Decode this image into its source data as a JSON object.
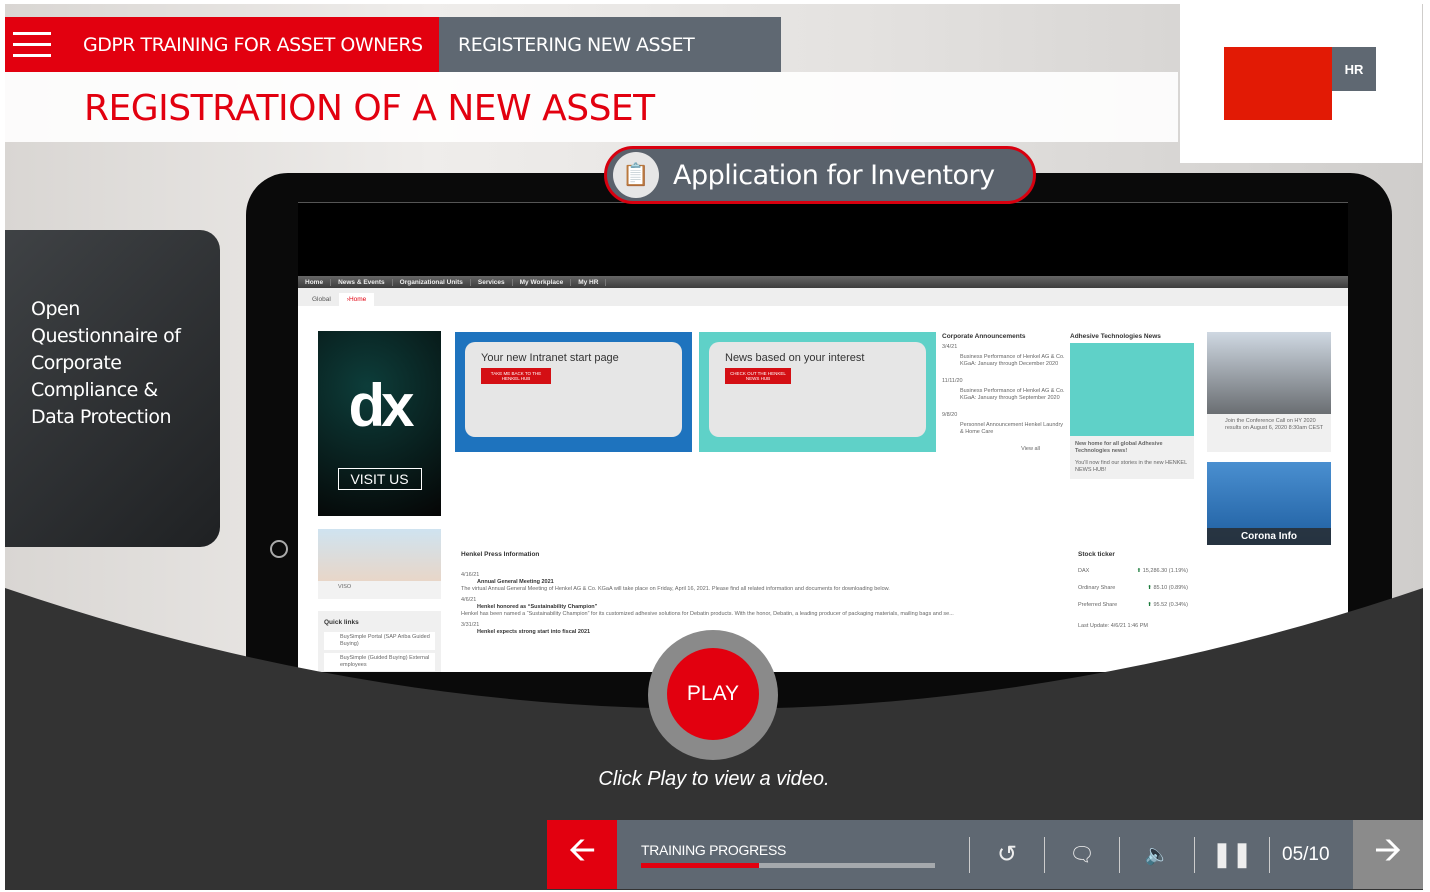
{
  "header": {
    "course": "GDPR TRAINING FOR ASSET OWNERS",
    "section": "REGISTERING NEW ASSET",
    "title": "REGISTRATION OF A NEW ASSET"
  },
  "logo": {
    "badge": "HR"
  },
  "pill": {
    "label": "Application for Inventory",
    "icon": "clipboard-inventory-icon"
  },
  "side_panel": {
    "text": "Open Questionnaire of Corporate Compliance & Data Protection"
  },
  "intranet": {
    "nav": [
      "Home",
      "News & Events",
      "Organizational Units",
      "Services",
      "My Workplace",
      "My HR"
    ],
    "tabs": [
      "Global",
      "›Home"
    ],
    "dx": {
      "logo": "dx",
      "button": "VISIT US"
    },
    "banner1": {
      "title": "Your new Intranet start page",
      "cta": "TAKE ME BACK TO THE HENKEL HUB"
    },
    "banner2": {
      "title": "News based on your interest",
      "cta": "CHECK OUT THE HENKEL NEWS HUB"
    },
    "corporate": {
      "heading": "Corporate Announcements",
      "items": [
        {
          "date": "3/4/21",
          "text": "Business Performance of Henkel AG & Co. KGaA: January through December 2020"
        },
        {
          "date": "11/11/20",
          "text": "Business Performance of Henkel AG & Co. KGaA: January through September 2020"
        },
        {
          "date": "9/8/20",
          "text": "Personnel Announcement Henkel Laundry & Home Care"
        }
      ],
      "view_all": "View all"
    },
    "adhesive": {
      "heading": "Adhesive Technologies News",
      "link": "New home for all global Adhesive Technologies news!",
      "text": "You'll now find our stories in the new HENKEL NEWS HUB!"
    },
    "conference": {
      "text": "Join the Conference Call on HY 2020 results on August 6, 2020 8:30am CEST"
    },
    "corona": {
      "label": "Corona Info"
    },
    "viso": {
      "label": "VISO"
    },
    "quick_links": {
      "heading": "Quick links",
      "items": [
        "BuySimple Portal (SAP Ariba Guided Buying)",
        "BuySimple (Guided Buying) External employees"
      ]
    },
    "press": {
      "heading": "Henkel Press Information",
      "items": [
        {
          "date": "4/16/21",
          "title": "Annual General Meeting 2021",
          "text": "The virtual Annual General Meeting of Henkel AG & Co. KGaA will take place on Friday, April 16, 2021. Please find all related information and documents for downloading below."
        },
        {
          "date": "4/6/21",
          "title": "Henkel honored as “Sustainability Champion”",
          "text": "Henkel has been named a “Sustainability Champion” for its customized adhesive solutions for Debatin products. With the honor, Debatin, a leading producer of packaging materials, mailing bags and se..."
        },
        {
          "date": "3/31/21",
          "title": "Henkel expects strong start into fiscal 2021",
          "text": ""
        }
      ]
    },
    "stock": {
      "heading": "Stock ticker",
      "rows": [
        {
          "name": "DAX",
          "value": "15,286.30",
          "change": "(1.19%)"
        },
        {
          "name": "Ordinary Share",
          "value": "85.10",
          "change": "(0.89%)"
        },
        {
          "name": "Preferred Share",
          "value": "95.52",
          "change": "(0.34%)"
        }
      ],
      "updated": "Last Update: 4/6/21 1:46 PM"
    }
  },
  "player": {
    "play": "PLAY",
    "caption": "Click Play to view a video.",
    "progress_label": "TRAINING PROGRESS",
    "progress": 0.4,
    "page": "05/10"
  },
  "colors": {
    "accent": "#e2000f",
    "bar": "#5f6872"
  }
}
